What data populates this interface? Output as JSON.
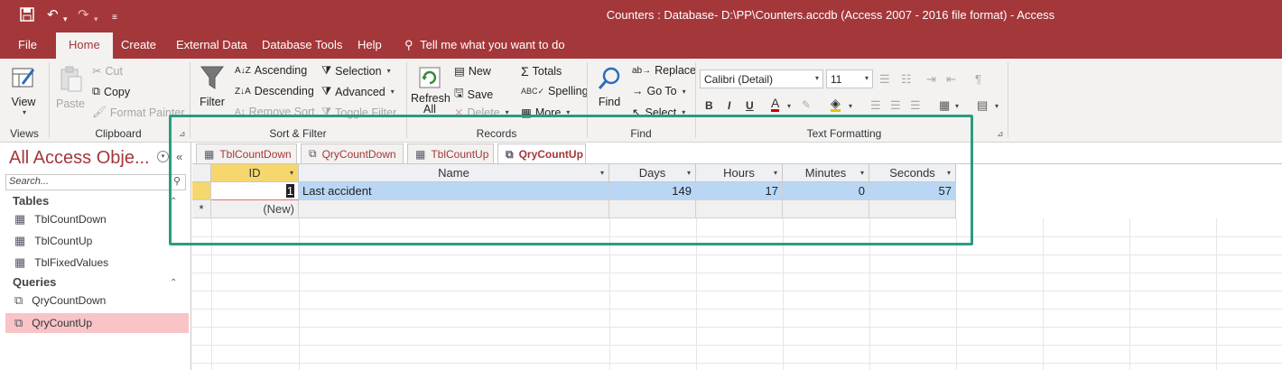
{
  "window": {
    "title": "Counters : Database- D:\\PP\\Counters.accdb (Access 2007 - 2016 file format)  -  Access"
  },
  "ribbon_tabs": [
    {
      "label": "File"
    },
    {
      "label": "Home"
    },
    {
      "label": "Create"
    },
    {
      "label": "External Data"
    },
    {
      "label": "Database Tools"
    },
    {
      "label": "Help"
    }
  ],
  "tell_me": "Tell me what you want to do",
  "ribbon": {
    "views": {
      "view": "View",
      "label": "Views"
    },
    "clipboard": {
      "paste": "Paste",
      "cut": "Cut",
      "copy": "Copy",
      "format_painter": "Format Painter",
      "label": "Clipboard"
    },
    "sort_filter": {
      "filter": "Filter",
      "ascending": "Ascending",
      "descending": "Descending",
      "remove_sort": "Remove Sort",
      "selection": "Selection",
      "advanced": "Advanced",
      "toggle_filter": "Toggle Filter",
      "label": "Sort & Filter"
    },
    "records": {
      "refresh": "Refresh",
      "refresh_all": "All",
      "new": "New",
      "save": "Save",
      "delete": "Delete",
      "totals": "Totals",
      "spelling": "Spelling",
      "more": "More",
      "label": "Records"
    },
    "find": {
      "find": "Find",
      "replace": "Replace",
      "goto": "Go To",
      "select": "Select",
      "label": "Find"
    },
    "text_formatting": {
      "font": "Calibri (Detail)",
      "size": "11",
      "bold": "B",
      "italic": "I",
      "underline": "U",
      "label": "Text Formatting"
    }
  },
  "nav": {
    "title": "All Access Obje...",
    "search_placeholder": "Search...",
    "sections": [
      {
        "header": "Tables",
        "items": [
          "TblCountDown",
          "TblCountUp",
          "TblFixedValues"
        ]
      },
      {
        "header": "Queries",
        "items": [
          "QryCountDown",
          "QryCountUp"
        ]
      }
    ],
    "selected": "QryCountUp"
  },
  "doc_tabs": [
    {
      "label": "TblCountDown",
      "kind": "table"
    },
    {
      "label": "QryCountDown",
      "kind": "query"
    },
    {
      "label": "TblCountUp",
      "kind": "table"
    },
    {
      "label": "QryCountUp",
      "kind": "query"
    }
  ],
  "grid": {
    "columns": [
      "ID",
      "Name",
      "Days",
      "Hours",
      "Minutes",
      "Seconds"
    ],
    "rows": [
      {
        "id": "1",
        "name": "Last accident",
        "days": "149",
        "hours": "17",
        "minutes": "0",
        "seconds": "57"
      }
    ],
    "new_row": "(New)",
    "new_marker": "*"
  },
  "colors": {
    "accent": "#a4373a",
    "highlight_box": "#2e9a80",
    "row_selected": "#b9d7f5",
    "nav_selected": "#f9c4c6"
  }
}
